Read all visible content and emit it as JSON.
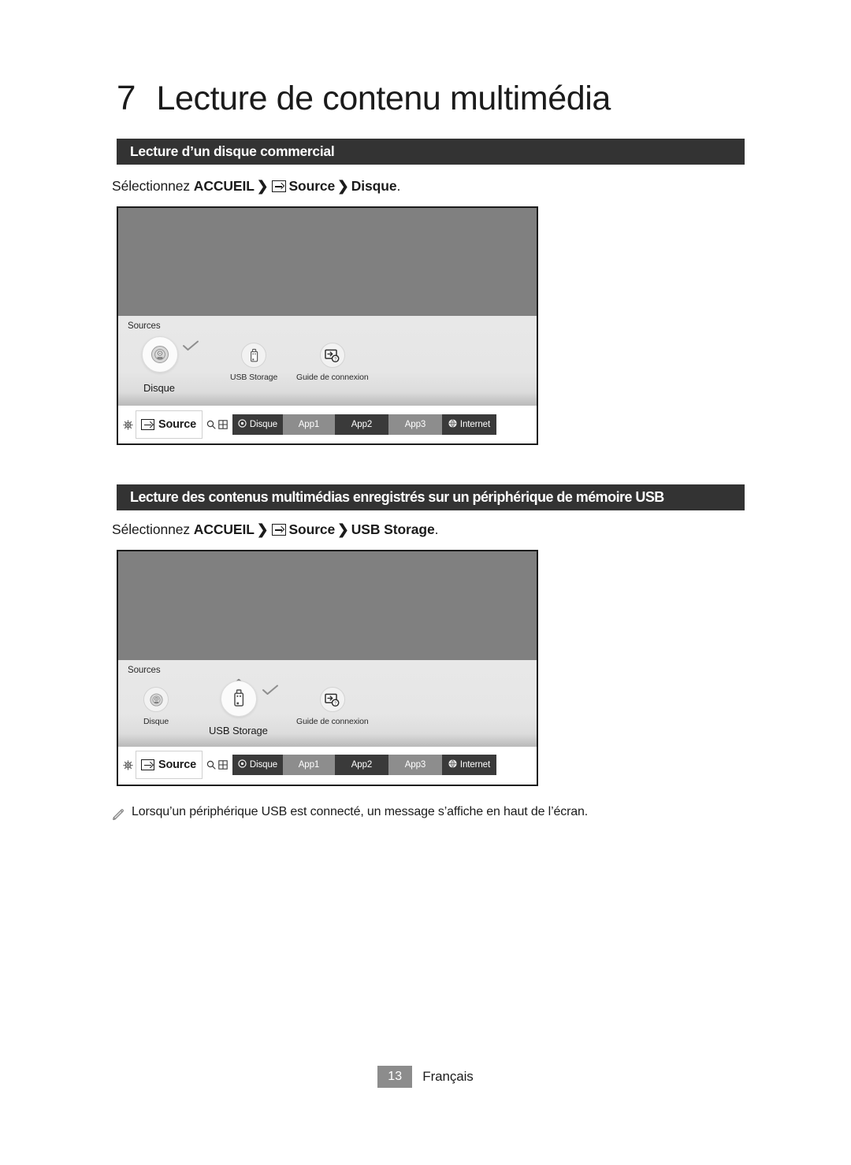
{
  "chapter": {
    "number": "7",
    "title": "Lecture de contenu multimédia"
  },
  "sections": [
    {
      "bar_title": "Lecture d’un disque commercial",
      "instruction": {
        "prefix": "Sélectionnez ",
        "home": "ACCUEIL",
        "chevron": "❯",
        "source_icon": "source-icon",
        "source": "Source",
        "chevron2": "❯",
        "target": "Disque",
        "suffix": "."
      }
    },
    {
      "bar_title": "Lecture des contenus multimédias enregistrés sur un périphérique de mémoire USB",
      "instruction": {
        "prefix": "Sélectionnez ",
        "home": "ACCUEIL",
        "chevron": "❯",
        "source_icon": "source-icon",
        "source": "Source",
        "chevron2": "❯",
        "target": "USB Storage",
        "suffix": "."
      }
    }
  ],
  "tv_mockups": [
    {
      "panel_label": "Sources",
      "selected": "Disque",
      "items": [
        {
          "label": "Disque",
          "icon": "disc-icon",
          "selected": true
        },
        {
          "label": "USB Storage",
          "icon": "usb-icon",
          "selected": false
        },
        {
          "label": "Guide de connexion",
          "icon": "connection-guide-icon",
          "selected": false
        }
      ],
      "launcher": {
        "settings_icon": "gear-icon",
        "source_label": "Source",
        "search_icon": "search-icon",
        "apps_icon": "apps-grid-icon",
        "apps": [
          {
            "label": "Disque",
            "style": "dark",
            "icon": "disc-small-icon"
          },
          {
            "label": "App1",
            "style": "light",
            "icon": ""
          },
          {
            "label": "App2",
            "style": "dark",
            "icon": ""
          },
          {
            "label": "App3",
            "style": "light",
            "icon": ""
          },
          {
            "label": "Internet",
            "style": "dark",
            "icon": "globe-icon"
          }
        ]
      }
    },
    {
      "panel_label": "Sources",
      "selected": "USB Storage",
      "items": [
        {
          "label": "Disque",
          "icon": "disc-icon",
          "selected": false
        },
        {
          "label": "USB Storage",
          "icon": "usb-icon",
          "selected": true
        },
        {
          "label": "Guide de connexion",
          "icon": "connection-guide-icon",
          "selected": false
        }
      ],
      "launcher": {
        "settings_icon": "gear-icon",
        "source_label": "Source",
        "search_icon": "search-icon",
        "apps_icon": "apps-grid-icon",
        "apps": [
          {
            "label": "Disque",
            "style": "dark",
            "icon": "disc-small-icon"
          },
          {
            "label": "App1",
            "style": "light",
            "icon": ""
          },
          {
            "label": "App2",
            "style": "dark",
            "icon": ""
          },
          {
            "label": "App3",
            "style": "light",
            "icon": ""
          },
          {
            "label": "Internet",
            "style": "dark",
            "icon": "globe-icon"
          }
        ]
      }
    }
  ],
  "note": {
    "icon": "pencil-note-icon",
    "text": "Lorsqu’un périphérique USB est connecté, un message s’affiche en haut de l’écran."
  },
  "footer": {
    "page_number": "13",
    "language": "Français"
  },
  "colors": {
    "bar_background": "#333333",
    "tv_screen": "#808080",
    "app_dark": "#3a3a3a",
    "app_light": "#8d8d8d",
    "page_badge": "#8c8c8c"
  }
}
